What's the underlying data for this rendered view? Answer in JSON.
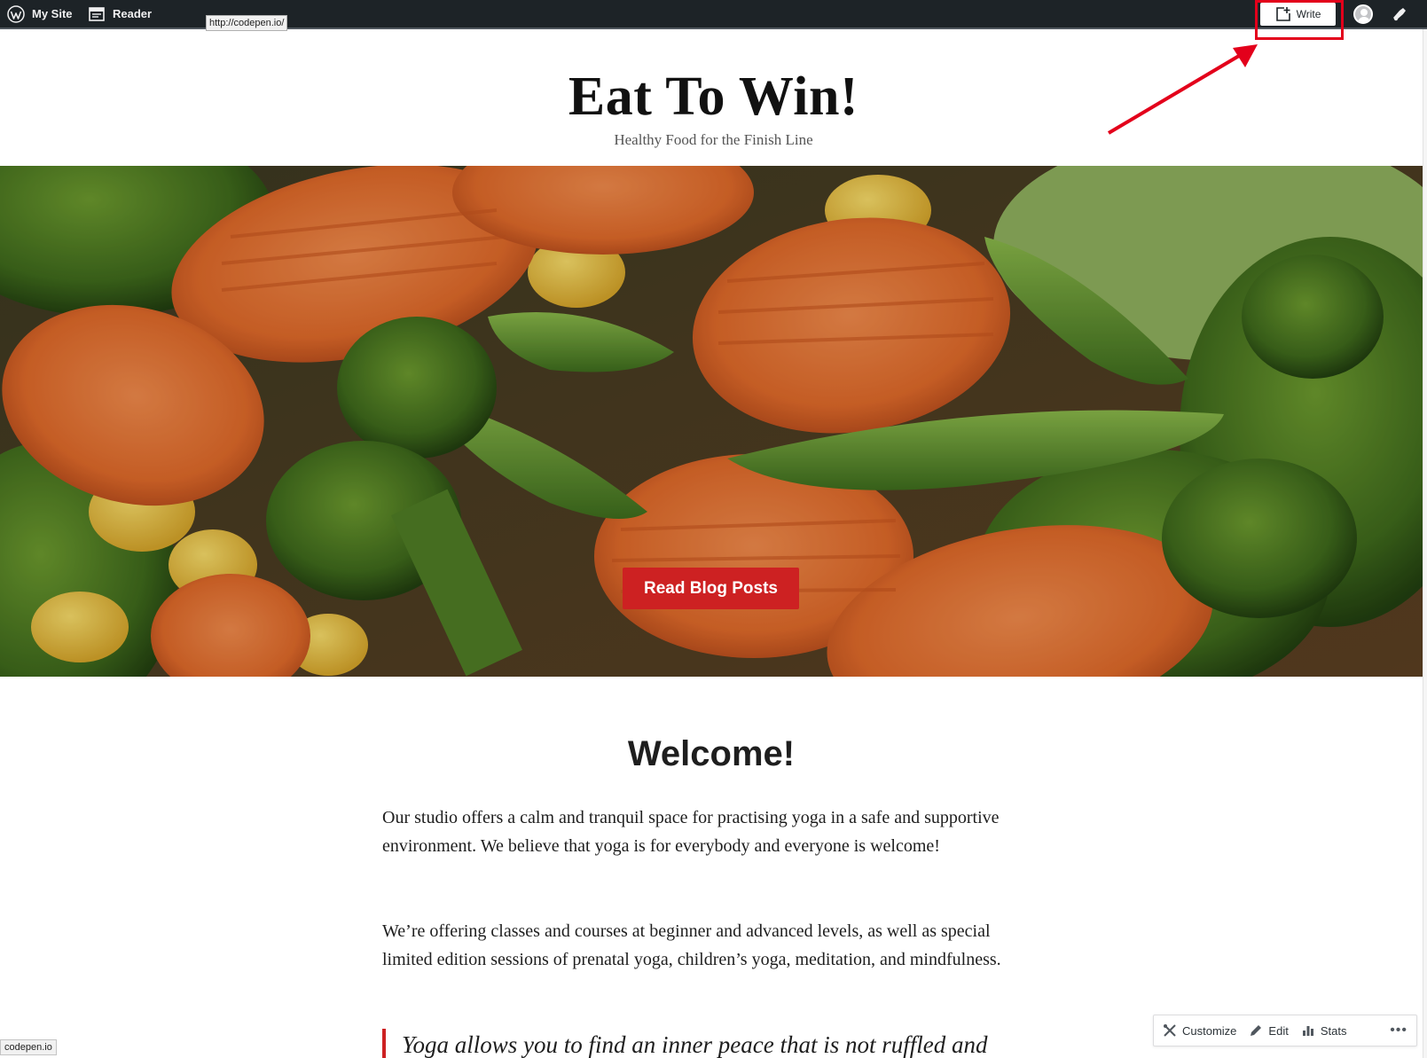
{
  "adminbar": {
    "my_site_label": "My Site",
    "reader_label": "Reader",
    "write_label": "Write",
    "url_tooltip": "http://codepen.io/"
  },
  "site": {
    "title": "Eat To Win!",
    "tagline": "Healthy Food for the Finish Line"
  },
  "hero": {
    "button_label": "Read Blog Posts"
  },
  "content": {
    "heading": "Welcome!",
    "paragraph1": "Our studio offers a calm and tranquil space for practising yoga in a safe and supportive environment. We believe that yoga is for everybody and everyone is welcome!",
    "paragraph2": "We’re offering classes and courses at beginner and advanced levels, as well as special limited edition sessions of prenatal yoga, children’s yoga, meditation, and mindfulness.",
    "quote": "Yoga allows you to find an inner peace that is not ruffled and"
  },
  "footer_toolbar": {
    "customize_label": "Customize",
    "edit_label": "Edit",
    "stats_label": "Stats",
    "more_label": "•••"
  },
  "status_bar": {
    "url": "codepen.io"
  },
  "colors": {
    "adminbar_bg": "#1d2327",
    "accent_red": "#cd2122",
    "annotation_red": "#e3001b"
  },
  "icons": [
    "wordpress-icon",
    "reader-icon",
    "write-icon",
    "avatar",
    "notifications-icon",
    "customize-icon",
    "edit-icon",
    "stats-icon"
  ]
}
